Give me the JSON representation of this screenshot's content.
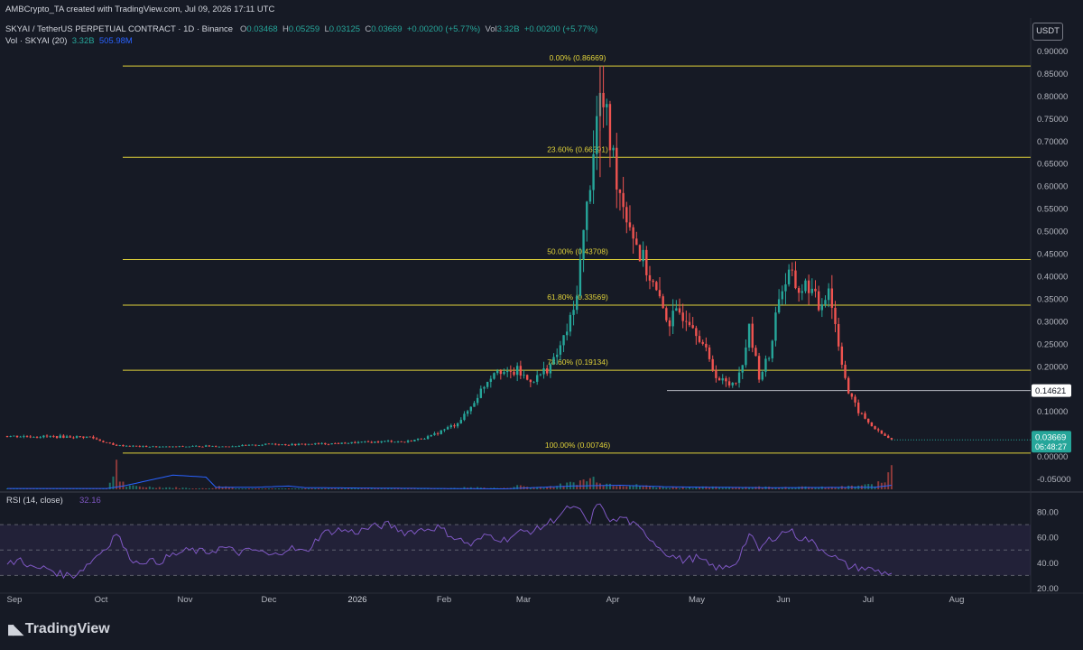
{
  "header": {
    "credit": "AMBCrypto_TA created with TradingView.com, Jul 09, 2026 17:11 UTC",
    "symbol": "SKYAI / TetherUS PERPETUAL CONTRACT · 1D · Binance",
    "o_label": "O",
    "o": "0.03468",
    "h_label": "H",
    "h": "0.05259",
    "l_label": "L",
    "l": "0.03125",
    "c_label": "C",
    "c": "0.03669",
    "change": "+0.00200 (+5.77%)",
    "vol_label": "Vol",
    "vol": "3.32B",
    "vol_change": "+0.00200 (+5.77%)",
    "vol_indicator": "Vol · SKYAI (20)",
    "vol_val1": "3.32B",
    "vol_val2": "505.98M",
    "unit": "USDT"
  },
  "branding": {
    "logo_text": "TradingView",
    "logo_icon": "tradingview-logo-icon"
  },
  "colors": {
    "up": "#26a69a",
    "down": "#ef5350",
    "fib": "#e0d23a",
    "rsi": "#7e57c2",
    "vol_ma": "#2962ff",
    "background": "#161a25"
  },
  "chart_data": [
    {
      "type": "candlestick",
      "y_ticks": [
        "0.90000",
        "0.85000",
        "0.80000",
        "0.75000",
        "0.70000",
        "0.65000",
        "0.60000",
        "0.55000",
        "0.50000",
        "0.45000",
        "0.40000",
        "0.35000",
        "0.30000",
        "0.25000",
        "0.20000",
        "0.15000",
        "0.10000",
        "0.05000",
        "0.00000",
        "-0.05000"
      ],
      "ylim": [
        -0.05,
        0.9
      ],
      "x_ticks": [
        "Sep",
        "Oct",
        "Nov",
        "Dec",
        "2026",
        "Feb",
        "Mar",
        "Apr",
        "May",
        "Jun",
        "Jul",
        "Aug"
      ],
      "fib_levels": [
        {
          "label": "0.00% (0.86669)",
          "value": 0.86669
        },
        {
          "label": "23.60% (0.66391)",
          "value": 0.66391
        },
        {
          "label": "50.00% (0.43708)",
          "value": 0.43708
        },
        {
          "label": "61.80% (0.33569)",
          "value": 0.33569
        },
        {
          "label": "78.60% (0.19134)",
          "value": 0.19134
        },
        {
          "label": "100.00% (0.00746)",
          "value": 0.00746
        }
      ],
      "horizontal_line": {
        "label": "0.14621",
        "value": 0.14621
      },
      "last_price": {
        "label": "0.03669",
        "value": 0.03669,
        "countdown": "06:48:27"
      },
      "price_path": [
        [
          0,
          0.045
        ],
        [
          25,
          0.043
        ],
        [
          32,
          0.025
        ],
        [
          40,
          0.022
        ],
        [
          48,
          0.021
        ],
        [
          55,
          0.022
        ],
        [
          60,
          0.023
        ],
        [
          65,
          0.022
        ],
        [
          75,
          0.025
        ],
        [
          80,
          0.028
        ],
        [
          85,
          0.026
        ],
        [
          95,
          0.028
        ],
        [
          101,
          0.029
        ],
        [
          106,
          0.031
        ],
        [
          111,
          0.032
        ],
        [
          116,
          0.034
        ],
        [
          120,
          0.032
        ],
        [
          124,
          0.038
        ],
        [
          128,
          0.045
        ],
        [
          132,
          0.06
        ],
        [
          135,
          0.07
        ],
        [
          138,
          0.09
        ],
        [
          140,
          0.11
        ],
        [
          142,
          0.135
        ],
        [
          145,
          0.17
        ],
        [
          148,
          0.2
        ],
        [
          151,
          0.18
        ],
        [
          154,
          0.19
        ],
        [
          157,
          0.17
        ],
        [
          160,
          0.175
        ],
        [
          165,
          0.21
        ],
        [
          168,
          0.26
        ],
        [
          171,
          0.32
        ],
        [
          173,
          0.43
        ],
        [
          175,
          0.55
        ],
        [
          177,
          0.69
        ],
        [
          179,
          0.8
        ],
        [
          181,
          0.74
        ],
        [
          183,
          0.66
        ],
        [
          185,
          0.59
        ],
        [
          188,
          0.52
        ],
        [
          191,
          0.45
        ],
        [
          194,
          0.4
        ],
        [
          197,
          0.34
        ],
        [
          200,
          0.3
        ],
        [
          203,
          0.32
        ],
        [
          206,
          0.31
        ],
        [
          209,
          0.27
        ],
        [
          212,
          0.21
        ],
        [
          215,
          0.17
        ],
        [
          218,
          0.16
        ],
        [
          221,
          0.18
        ],
        [
          224,
          0.28
        ],
        [
          227,
          0.18
        ],
        [
          230,
          0.22
        ],
        [
          233,
          0.36
        ],
        [
          236,
          0.4
        ],
        [
          239,
          0.37
        ],
        [
          242,
          0.38
        ],
        [
          245,
          0.33
        ],
        [
          248,
          0.38
        ],
        [
          251,
          0.25
        ],
        [
          254,
          0.14
        ],
        [
          257,
          0.1
        ],
        [
          260,
          0.075
        ],
        [
          263,
          0.055
        ],
        [
          265,
          0.045
        ],
        [
          267,
          0.0367
        ]
      ],
      "volume_path": [
        [
          0,
          0.01
        ],
        [
          30,
          0.01
        ],
        [
          32,
          0.35
        ],
        [
          33,
          0.8
        ],
        [
          34,
          0.25
        ],
        [
          36,
          0.08
        ],
        [
          60,
          0.02
        ],
        [
          65,
          0.08
        ],
        [
          70,
          0.02
        ],
        [
          130,
          0.01
        ],
        [
          140,
          0.05
        ],
        [
          150,
          0.03
        ],
        [
          155,
          0.1
        ],
        [
          158,
          0.05
        ],
        [
          165,
          0.08
        ],
        [
          170,
          0.15
        ],
        [
          175,
          0.25
        ],
        [
          178,
          0.3
        ],
        [
          180,
          0.15
        ],
        [
          200,
          0.05
        ],
        [
          230,
          0.06
        ],
        [
          250,
          0.05
        ],
        [
          262,
          0.12
        ],
        [
          265,
          0.2
        ],
        [
          267,
          0.8
        ]
      ],
      "volume_ma": [
        [
          0,
          0.02
        ],
        [
          30,
          0.02
        ],
        [
          35,
          0.08
        ],
        [
          50,
          0.35
        ],
        [
          60,
          0.3
        ],
        [
          63,
          0.05
        ],
        [
          75,
          0.05
        ],
        [
          85,
          0.08
        ],
        [
          90,
          0.04
        ],
        [
          150,
          0.01
        ],
        [
          170,
          0.08
        ],
        [
          185,
          0.1
        ],
        [
          200,
          0.06
        ],
        [
          230,
          0.04
        ],
        [
          262,
          0.05
        ],
        [
          267,
          0.1
        ]
      ]
    },
    {
      "type": "line",
      "title": "RSI (14, close)",
      "value_label": "32.16",
      "y_ticks": [
        "80.00",
        "60.00",
        "40.00",
        "20.00"
      ],
      "ylim": [
        20,
        90
      ],
      "bands": [
        30,
        50,
        70
      ],
      "rsi_path": [
        [
          0,
          38
        ],
        [
          4,
          43
        ],
        [
          8,
          35
        ],
        [
          12,
          36
        ],
        [
          16,
          31
        ],
        [
          20,
          30
        ],
        [
          24,
          38
        ],
        [
          28,
          48
        ],
        [
          30,
          52
        ],
        [
          33,
          64
        ],
        [
          36,
          48
        ],
        [
          39,
          40
        ],
        [
          42,
          42
        ],
        [
          45,
          40
        ],
        [
          50,
          46
        ],
        [
          55,
          50
        ],
        [
          60,
          48
        ],
        [
          65,
          52
        ],
        [
          70,
          48
        ],
        [
          75,
          50
        ],
        [
          80,
          45
        ],
        [
          85,
          52
        ],
        [
          90,
          48
        ],
        [
          95,
          63
        ],
        [
          100,
          66
        ],
        [
          105,
          64
        ],
        [
          110,
          68
        ],
        [
          115,
          70
        ],
        [
          120,
          64
        ],
        [
          125,
          66
        ],
        [
          130,
          68
        ],
        [
          135,
          60
        ],
        [
          140,
          54
        ],
        [
          145,
          62
        ],
        [
          150,
          58
        ],
        [
          155,
          64
        ],
        [
          160,
          66
        ],
        [
          165,
          74
        ],
        [
          170,
          84
        ],
        [
          173,
          80
        ],
        [
          176,
          70
        ],
        [
          178,
          88
        ],
        [
          180,
          80
        ],
        [
          183,
          72
        ],
        [
          186,
          76
        ],
        [
          190,
          68
        ],
        [
          194,
          60
        ],
        [
          197,
          52
        ],
        [
          200,
          46
        ],
        [
          204,
          42
        ],
        [
          208,
          44
        ],
        [
          212,
          38
        ],
        [
          216,
          35
        ],
        [
          220,
          40
        ],
        [
          224,
          62
        ],
        [
          227,
          50
        ],
        [
          230,
          58
        ],
        [
          233,
          62
        ],
        [
          236,
          66
        ],
        [
          239,
          60
        ],
        [
          242,
          58
        ],
        [
          245,
          52
        ],
        [
          248,
          48
        ],
        [
          251,
          42
        ],
        [
          254,
          37
        ],
        [
          258,
          36
        ],
        [
          262,
          34
        ],
        [
          265,
          32
        ],
        [
          267,
          32.16
        ]
      ]
    }
  ]
}
